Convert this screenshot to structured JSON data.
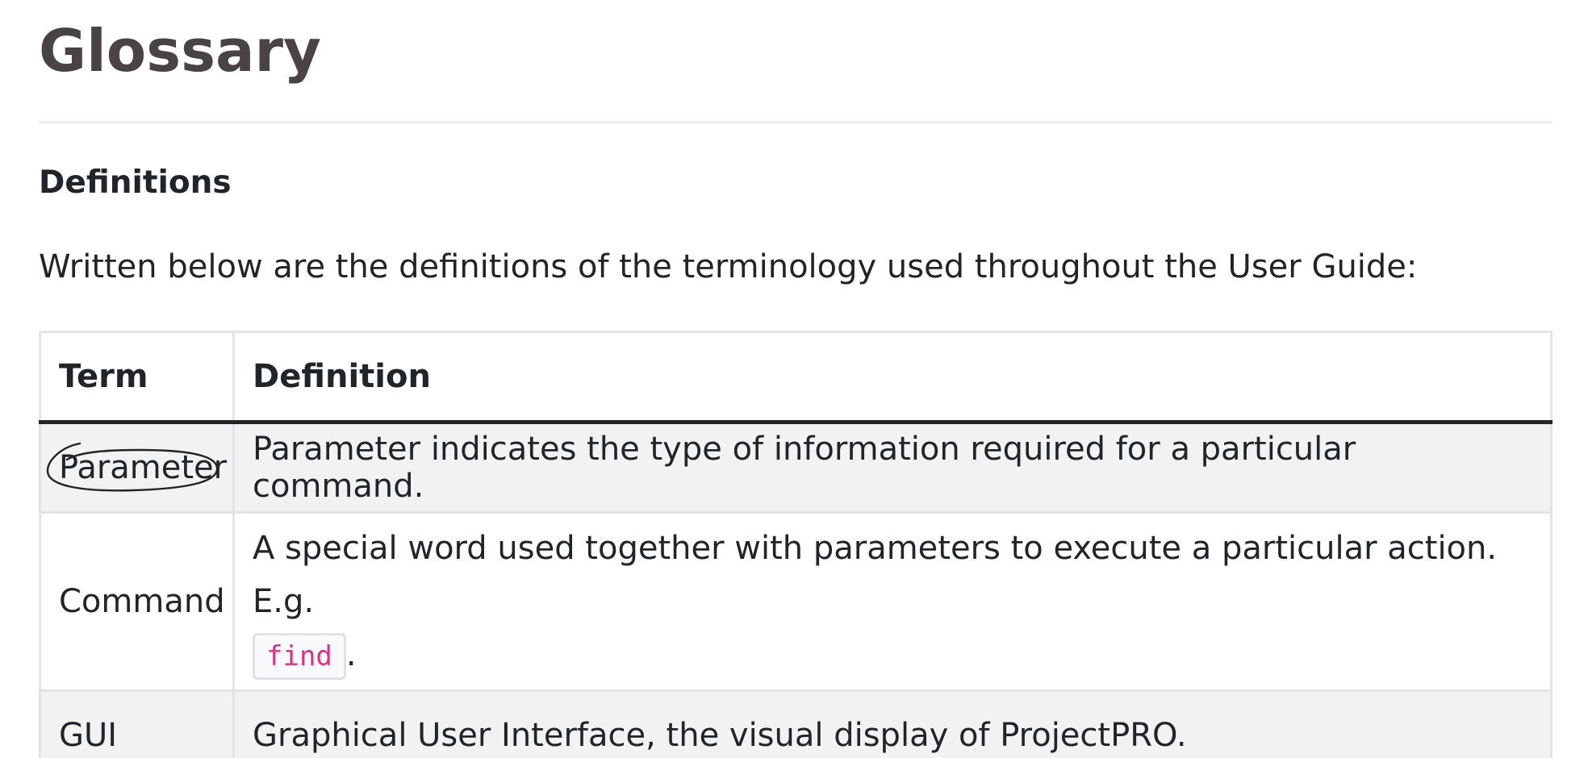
{
  "page": {
    "title": "Glossary",
    "section_heading": "Definitions",
    "intro": "Written below are the definitions of the terminology used throughout the User Guide:"
  },
  "table": {
    "headers": [
      "Term",
      "Definition"
    ],
    "rows": [
      {
        "term": "Parameter",
        "definition": "Parameter indicates the type of information required for a particular command.",
        "annotated": true
      },
      {
        "term": "Command",
        "definition": "A special word used together with parameters to execute a particular action. E.g.",
        "code": "find",
        "trailing": "."
      },
      {
        "term": "GUI",
        "definition": "Graphical User Interface, the visual display of ProjectPRO."
      }
    ]
  },
  "colors": {
    "title": "#4a4346",
    "text": "#212529",
    "code_text": "#d63384",
    "row_stripe": "#f2f2f2"
  },
  "annotation": {
    "type": "hand-drawn-circle",
    "target": "Parameter"
  }
}
